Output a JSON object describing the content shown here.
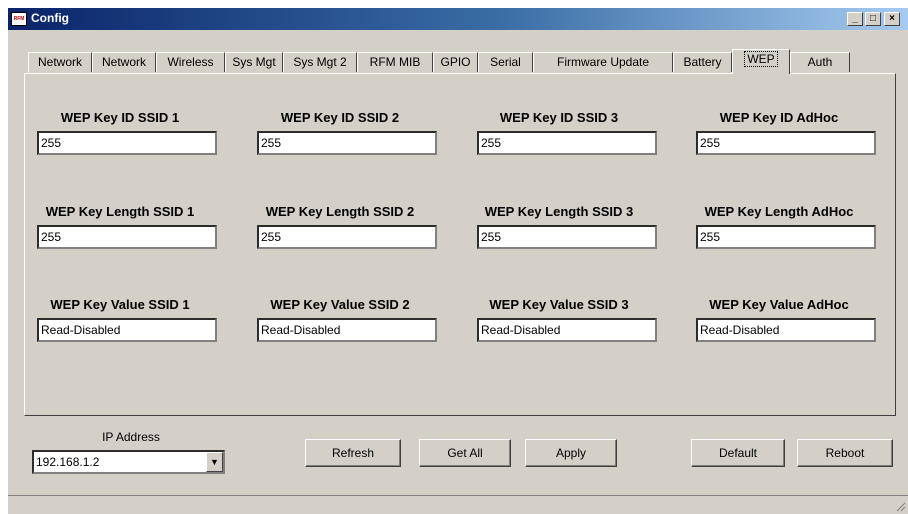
{
  "window": {
    "title": "Config",
    "icon_text": "RFM"
  },
  "tabs": [
    "Network",
    "Network",
    "Wireless",
    "Sys Mgt",
    "Sys Mgt 2",
    "RFM MIB",
    "GPIO",
    "Serial",
    "Firmware Update",
    "Battery",
    "WEP",
    "Auth"
  ],
  "active_tab": "WEP",
  "wep": {
    "key_id": [
      {
        "label": "WEP Key ID SSID 1",
        "value": "255"
      },
      {
        "label": "WEP Key ID SSID 2",
        "value": "255"
      },
      {
        "label": "WEP Key ID SSID 3",
        "value": "255"
      },
      {
        "label": "WEP Key ID AdHoc",
        "value": "255"
      }
    ],
    "key_length": [
      {
        "label": "WEP Key Length SSID 1",
        "value": "255"
      },
      {
        "label": "WEP Key Length SSID 2",
        "value": "255"
      },
      {
        "label": "WEP Key Length SSID 3",
        "value": "255"
      },
      {
        "label": "WEP Key Length AdHoc",
        "value": "255"
      }
    ],
    "key_value": [
      {
        "label": "WEP Key Value SSID 1",
        "value": "Read-Disabled"
      },
      {
        "label": "WEP Key Value SSID 2",
        "value": "Read-Disabled"
      },
      {
        "label": "WEP Key Value SSID 3",
        "value": "Read-Disabled"
      },
      {
        "label": "WEP Key Value AdHoc",
        "value": "Read-Disabled"
      }
    ]
  },
  "ip": {
    "label": "IP Address",
    "value": "192.168.1.2"
  },
  "buttons": {
    "refresh": "Refresh",
    "get_all": "Get All",
    "apply": "Apply",
    "default": "Default",
    "reboot": "Reboot"
  }
}
